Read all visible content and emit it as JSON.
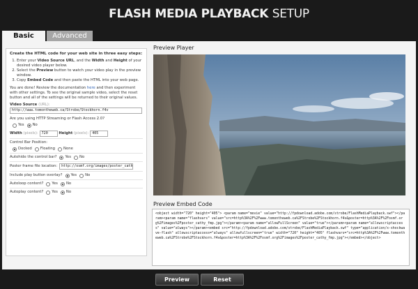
{
  "header": {
    "title_bold": "FLASH MEDIA PLAYBACK",
    "title_light": "SETUP"
  },
  "tabs": [
    {
      "label": "Basic",
      "active": true
    },
    {
      "label": "Advanced",
      "active": false
    }
  ],
  "instructions": {
    "heading": "Create the HTML code for your web site in three easy steps:",
    "steps": [
      [
        "Enter your ",
        "Video Source URL",
        ", and the ",
        "Width",
        " and ",
        "Height",
        " of your desired video player below."
      ],
      [
        "Select the ",
        "Preview",
        " button to watch your video play in the preview window."
      ],
      [
        "Copy ",
        "Embed Code",
        " and then paste the HTML into your web page."
      ]
    ],
    "done_pre": "You are done! Review the documentation ",
    "done_link": "here",
    "done_post": " and then experiment with other settings. To see the original sample video, select the reset button and all of the settings will be returned to their original values."
  },
  "form": {
    "video_source_label": "Video Source",
    "video_source_hint": "(URL):",
    "video_source_value": "http://www.tomontheweb.ca/Strobe/Stockhorn.f4v",
    "http_question": "Are you using HTTP Streaming or Flash Access 2.0?",
    "http_options": [
      "Yes",
      "No"
    ],
    "width_label": "Width",
    "width_hint": "(pixels):",
    "width_value": "720",
    "height_label": "Height",
    "height_hint": "(pixels):",
    "height_value": "405",
    "control_bar_label": "Control Bar Position:",
    "control_bar_options": [
      "Docked",
      "Floating",
      "None"
    ],
    "autohide_label": "Autohide the control bar?",
    "autohide_options": [
      "Yes",
      "No"
    ],
    "poster_label": "Poster frame file location:",
    "poster_value": "http://osmf.org/images/poster_cathy_fm",
    "play_overlay_label": "Include play button overlay?",
    "play_overlay_options": [
      "Yes",
      "No"
    ],
    "autoloop_label": "Autoloop content?",
    "autoloop_options": [
      "Yes",
      "No"
    ],
    "autoplay_label": "Autoplay content?",
    "autoplay_options": [
      "Yes",
      "No"
    ]
  },
  "preview": {
    "label": "Preview Player"
  },
  "embed": {
    "label": "Preview Embed Code",
    "code": "<object width=\"720\" height=\"405\"> <param name=\"movie\" value=\"http://fpdownload.adobe.com/strobe/FlashMediaPlayback.swf\"></param><param name=\"flashvars\" value=\"src=http%3A%2F%2Fwww.tomontheweb.ca%2FStrobe%2FStockhorn.f4v&poster=http%3A%2F%2Fosmf.org%2Fimages%2Fposter_cathy_fmp.jpg\"></param><param name=\"allowFullScreen\" value=\"true\"></param><param name=\"allowscriptaccess\" value=\"always\"></param><embed src=\"http://fpdownload.adobe.com/strobe/FlashMediaPlayback.swf\" type=\"application/x-shockwave-flash\" allowscriptaccess=\"always\" allowfullscreen=\"true\" width=\"720\" height=\"405\" flashvars=\"src=http%3A%2F%2Fwww.tomontheweb.ca%2FStrobe%2FStockhorn.f4v&poster=http%3A%2F%2Fosmf.org%2Fimages%2Fposter_cathy_fmp.jpg\"></embed></object>"
  },
  "buttons": {
    "preview": "Preview",
    "reset": "Reset"
  }
}
